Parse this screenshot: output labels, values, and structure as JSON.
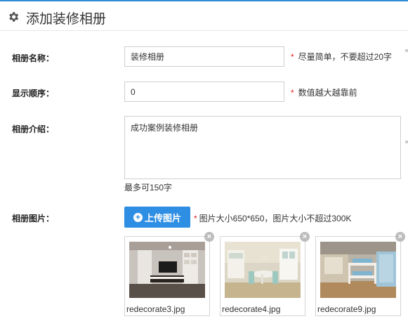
{
  "page": {
    "title": "添加装修相册"
  },
  "form": {
    "name": {
      "label": "相册名称：",
      "value": "装修相册",
      "hint": "尽量简单，不要超过20字"
    },
    "order": {
      "label": "显示顺序：",
      "value": "0",
      "hint": "数值越大越靠前"
    },
    "intro": {
      "label": "相册介绍：",
      "value": "成功案例装修相册",
      "count_hint": "最多可150字"
    },
    "images": {
      "label": "相册图片：",
      "upload_label": "上传图片",
      "hint": "图片大小650*650，图片大小不超过300K",
      "files": [
        {
          "filename": "redecorate3.jpg"
        },
        {
          "filename": "redecorate4.jpg"
        },
        {
          "filename": "redecorate9.jpg"
        }
      ]
    }
  },
  "symbols": {
    "required": "*",
    "plus": "+",
    "close": "×"
  },
  "colors": {
    "accent": "#2e8ee3",
    "required": "#e02020",
    "topline": "#2f8ad8"
  }
}
